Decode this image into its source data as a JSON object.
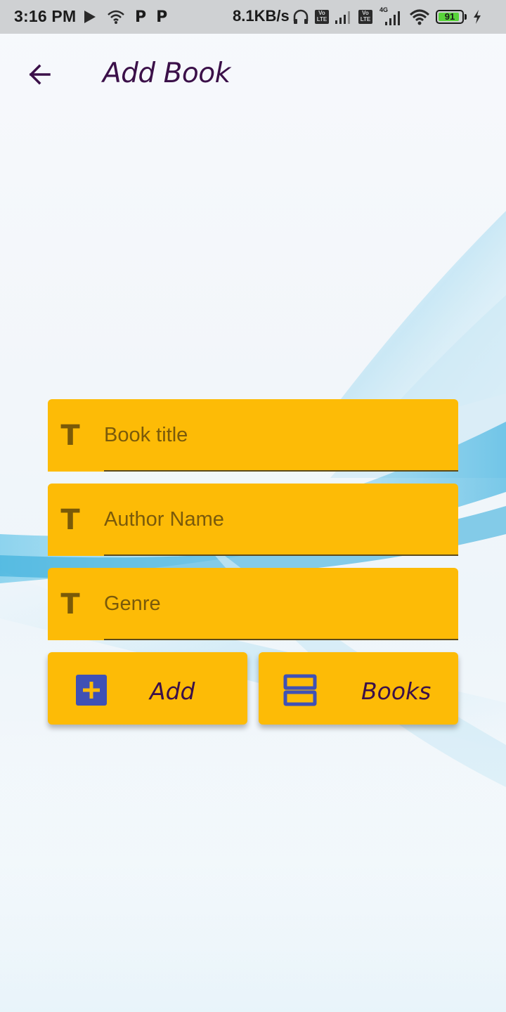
{
  "status_bar": {
    "time": "3:16 PM",
    "speed": "8.1KB/s",
    "battery": "91",
    "battery_level": 0.91,
    "icons": [
      "play-icon",
      "wifi-sync-icon",
      "p-icon",
      "p-icon",
      "headphones-icon",
      "volte-icon",
      "signal-icon",
      "volte-icon",
      "4g-signal-icon",
      "wifi-icon",
      "battery-icon",
      "charging-icon"
    ],
    "volte_label": "Vo LTE",
    "network_label": "4G",
    "p_label": "P"
  },
  "app_bar": {
    "title": "Add Book",
    "back_icon": "arrow-left-icon"
  },
  "form": {
    "fields": [
      {
        "name": "book-title-input",
        "placeholder": "Book title",
        "value": "",
        "icon": "text-t-icon",
        "icon_glyph": "T"
      },
      {
        "name": "author-name-input",
        "placeholder": "Author Name",
        "value": "",
        "icon": "text-t-icon",
        "icon_glyph": "T"
      },
      {
        "name": "genre-input",
        "placeholder": "Genre",
        "value": "",
        "icon": "text-t-icon",
        "icon_glyph": "T"
      }
    ]
  },
  "actions": {
    "add_label": "Add",
    "add_icon": "add-box-icon",
    "books_label": "Books",
    "books_icon": "view-list-icon"
  },
  "colors": {
    "accent": "#fdbb06",
    "title_text": "#3b1049",
    "icon_blue": "#3f51b5",
    "field_icon": "#7a5a08"
  }
}
